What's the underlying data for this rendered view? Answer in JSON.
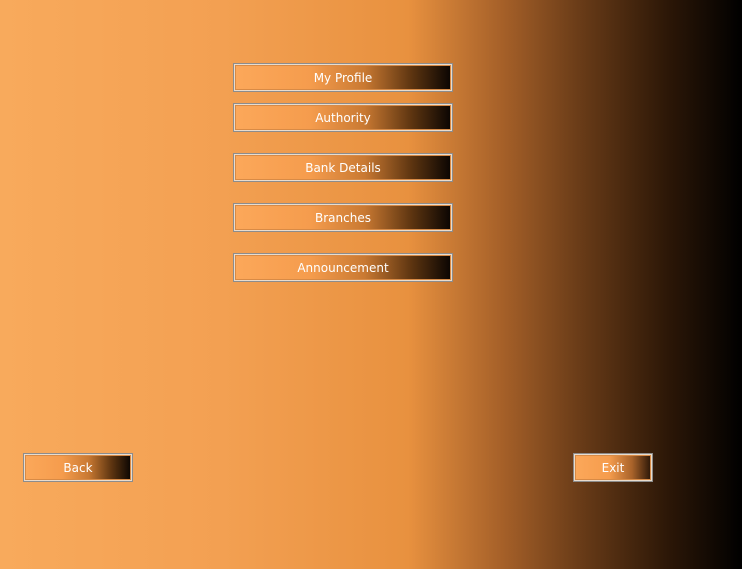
{
  "menu": {
    "my_profile_label": "My Profile",
    "authority_label": "Authority",
    "bank_details_label": "Bank Details",
    "branches_label": "Branches",
    "announcement_label": "Announcement"
  },
  "footer": {
    "back_label": "Back",
    "exit_label": "Exit"
  },
  "colors": {
    "background_light": "#f8aa5c",
    "background_mid": "#e8913f",
    "background_dark": "#000000",
    "button_border": "#e9dccd",
    "button_text": "#ffffff"
  }
}
